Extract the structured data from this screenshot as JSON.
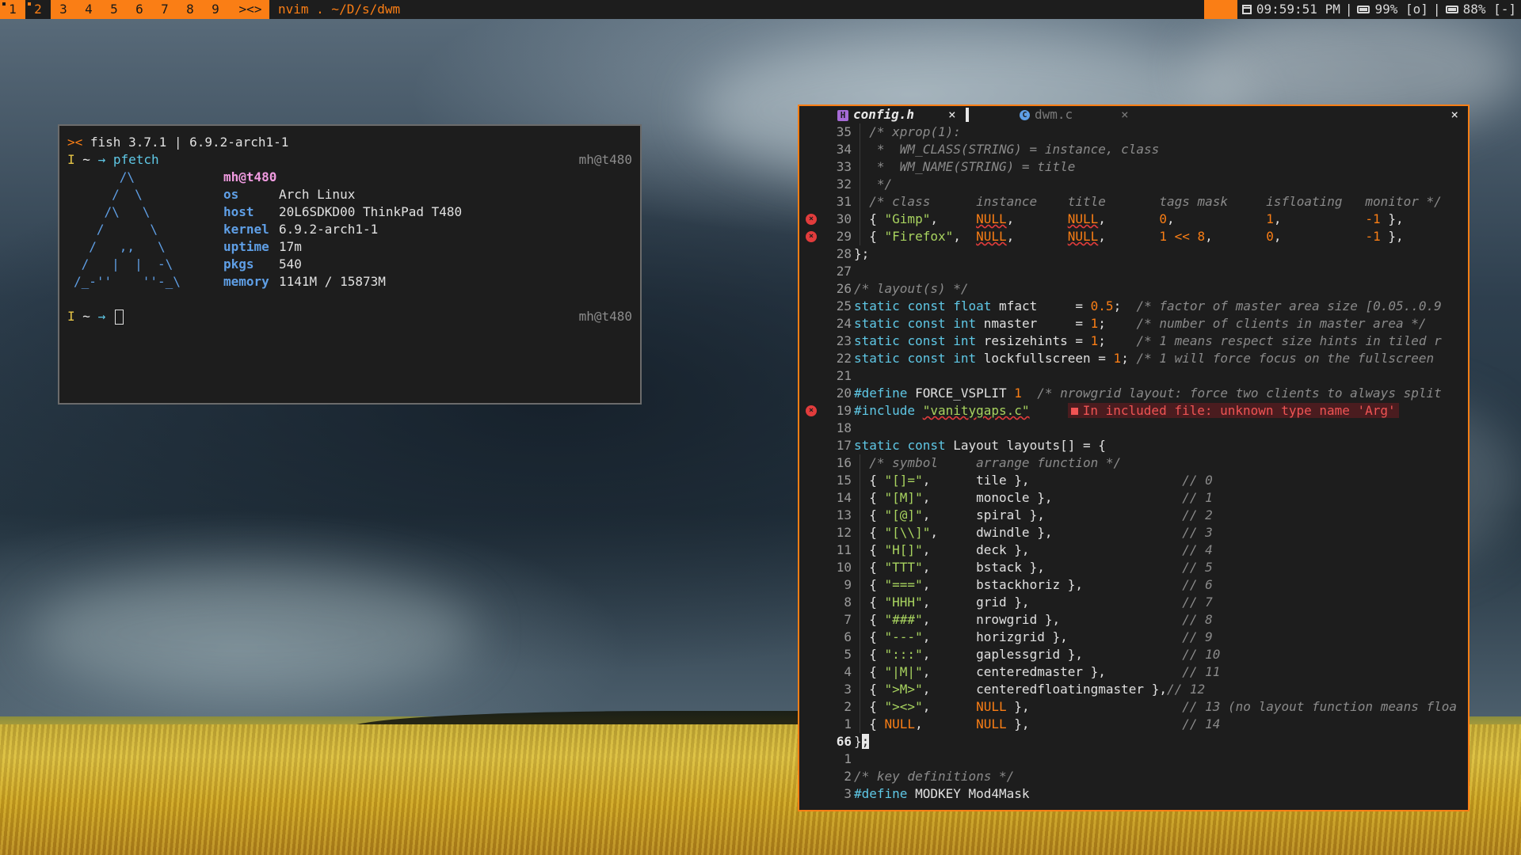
{
  "bar": {
    "tags": [
      "1",
      "2",
      "3",
      "4",
      "5",
      "6",
      "7",
      "8",
      "9"
    ],
    "layout_symbol": "><>",
    "window_title": "nvim . ~/D/s/dwm",
    "clock": "09:59:51 PM",
    "battery1": "99% [o]",
    "battery2": "88% [-]",
    "separator": "|",
    "icons": {
      "clock": "calendar-icon",
      "battery": "battery-icon"
    }
  },
  "terminal": {
    "header_prompt": "><",
    "header_text": "fish 3.7.1 | 6.9.2-arch1-1",
    "prompt_mode": "I",
    "prompt_path": "~",
    "prompt_arrow": "→",
    "command": "pfetch",
    "right_prompt": "mh@t480",
    "ascii_art": [
      "      /\\",
      "     /  \\",
      "    /\\   \\",
      "   /      \\",
      "  /   ,,   \\",
      " /   |  |  -\\",
      "/_-''    ''-_\\"
    ],
    "pfetch": {
      "user": "mh@t480",
      "rows": [
        {
          "label": "os",
          "value": "Arch Linux"
        },
        {
          "label": "host",
          "value": "20L6SDKD00 ThinkPad T480"
        },
        {
          "label": "kernel",
          "value": "6.9.2-arch1-1"
        },
        {
          "label": "uptime",
          "value": "17m"
        },
        {
          "label": "pkgs",
          "value": "540"
        },
        {
          "label": "memory",
          "value": "1141M / 15873M"
        }
      ]
    }
  },
  "nvim": {
    "tabs": [
      {
        "icon": "H",
        "name": "config.h",
        "close": "×",
        "active": true
      },
      {
        "icon": "C",
        "name": "dwm.c",
        "close": "×",
        "active": false
      }
    ],
    "window_close": "×",
    "current_line": "66",
    "diagnostic": "In included file: unknown type name 'Arg'",
    "lines": [
      {
        "n": "35",
        "t": "  /* xprop(1):"
      },
      {
        "n": "34",
        "t": "   *  WM_CLASS(STRING) = instance, class"
      },
      {
        "n": "33",
        "t": "   *  WM_NAME(STRING) = title"
      },
      {
        "n": "32",
        "t": "   */"
      },
      {
        "n": "31",
        "t": "  /* class      instance    title       tags mask     isfloating   monitor */"
      },
      {
        "n": "30",
        "t": "  { \"Gimp\",     NULL,       NULL,       0,            1,           -1 },",
        "sign": true
      },
      {
        "n": "29",
        "t": "  { \"Firefox\",  NULL,       NULL,       1 << 8,       0,           -1 },",
        "sign": true
      },
      {
        "n": "28",
        "t": "};"
      },
      {
        "n": "27",
        "t": ""
      },
      {
        "n": "26",
        "t": "/* layout(s) */"
      },
      {
        "n": "25",
        "t": "static const float mfact     = 0.5;  /* factor of master area size [0.05..0.9"
      },
      {
        "n": "24",
        "t": "static const int nmaster     = 1;    /* number of clients in master area */"
      },
      {
        "n": "23",
        "t": "static const int resizehints = 1;    /* 1 means respect size hints in tiled r"
      },
      {
        "n": "22",
        "t": "static const int lockfullscreen = 1; /* 1 will force focus on the fullscreen"
      },
      {
        "n": "21",
        "t": ""
      },
      {
        "n": "20",
        "t": "#define FORCE_VSPLIT 1  /* nrowgrid layout: force two clients to always split"
      },
      {
        "n": "19",
        "t": "#include \"vanitygaps.c\"",
        "sign": true
      },
      {
        "n": "18",
        "t": ""
      },
      {
        "n": "17",
        "t": "static const Layout layouts[] = {"
      },
      {
        "n": "16",
        "t": "  /* symbol     arrange function */"
      },
      {
        "n": "15",
        "t": "  { \"[]=\",      tile },                    // 0"
      },
      {
        "n": "14",
        "t": "  { \"[M]\",      monocle },                 // 1"
      },
      {
        "n": "13",
        "t": "  { \"[@]\",      spiral },                  // 2"
      },
      {
        "n": "12",
        "t": "  { \"[\\\\]\",     dwindle },                 // 3"
      },
      {
        "n": "11",
        "t": "  { \"H[]\",      deck },                    // 4"
      },
      {
        "n": "10",
        "t": "  { \"TTT\",      bstack },                  // 5"
      },
      {
        "n": "9",
        "t": "  { \"===\",      bstackhoriz },             // 6"
      },
      {
        "n": "8",
        "t": "  { \"HHH\",      grid },                    // 7"
      },
      {
        "n": "7",
        "t": "  { \"###\",      nrowgrid },                // 8"
      },
      {
        "n": "6",
        "t": "  { \"---\",      horizgrid },               // 9"
      },
      {
        "n": "5",
        "t": "  { \":::\",      gaplessgrid },             // 10"
      },
      {
        "n": "4",
        "t": "  { \"|M|\",      centeredmaster },          // 11"
      },
      {
        "n": "3",
        "t": "  { \">M>\",      centeredfloatingmaster },// 12"
      },
      {
        "n": "2",
        "t": "  { \"><>\",      NULL },                    // 13 (no layout function means floa"
      },
      {
        "n": "1",
        "t": "  { NULL,       NULL },                    // 14"
      },
      {
        "n": "66",
        "t": "};",
        "cur": true
      },
      {
        "n": "1",
        "t": ""
      },
      {
        "n": "2",
        "t": "/* key definitions */"
      },
      {
        "n": "3",
        "t": "#define MODKEY Mod4Mask"
      }
    ]
  }
}
